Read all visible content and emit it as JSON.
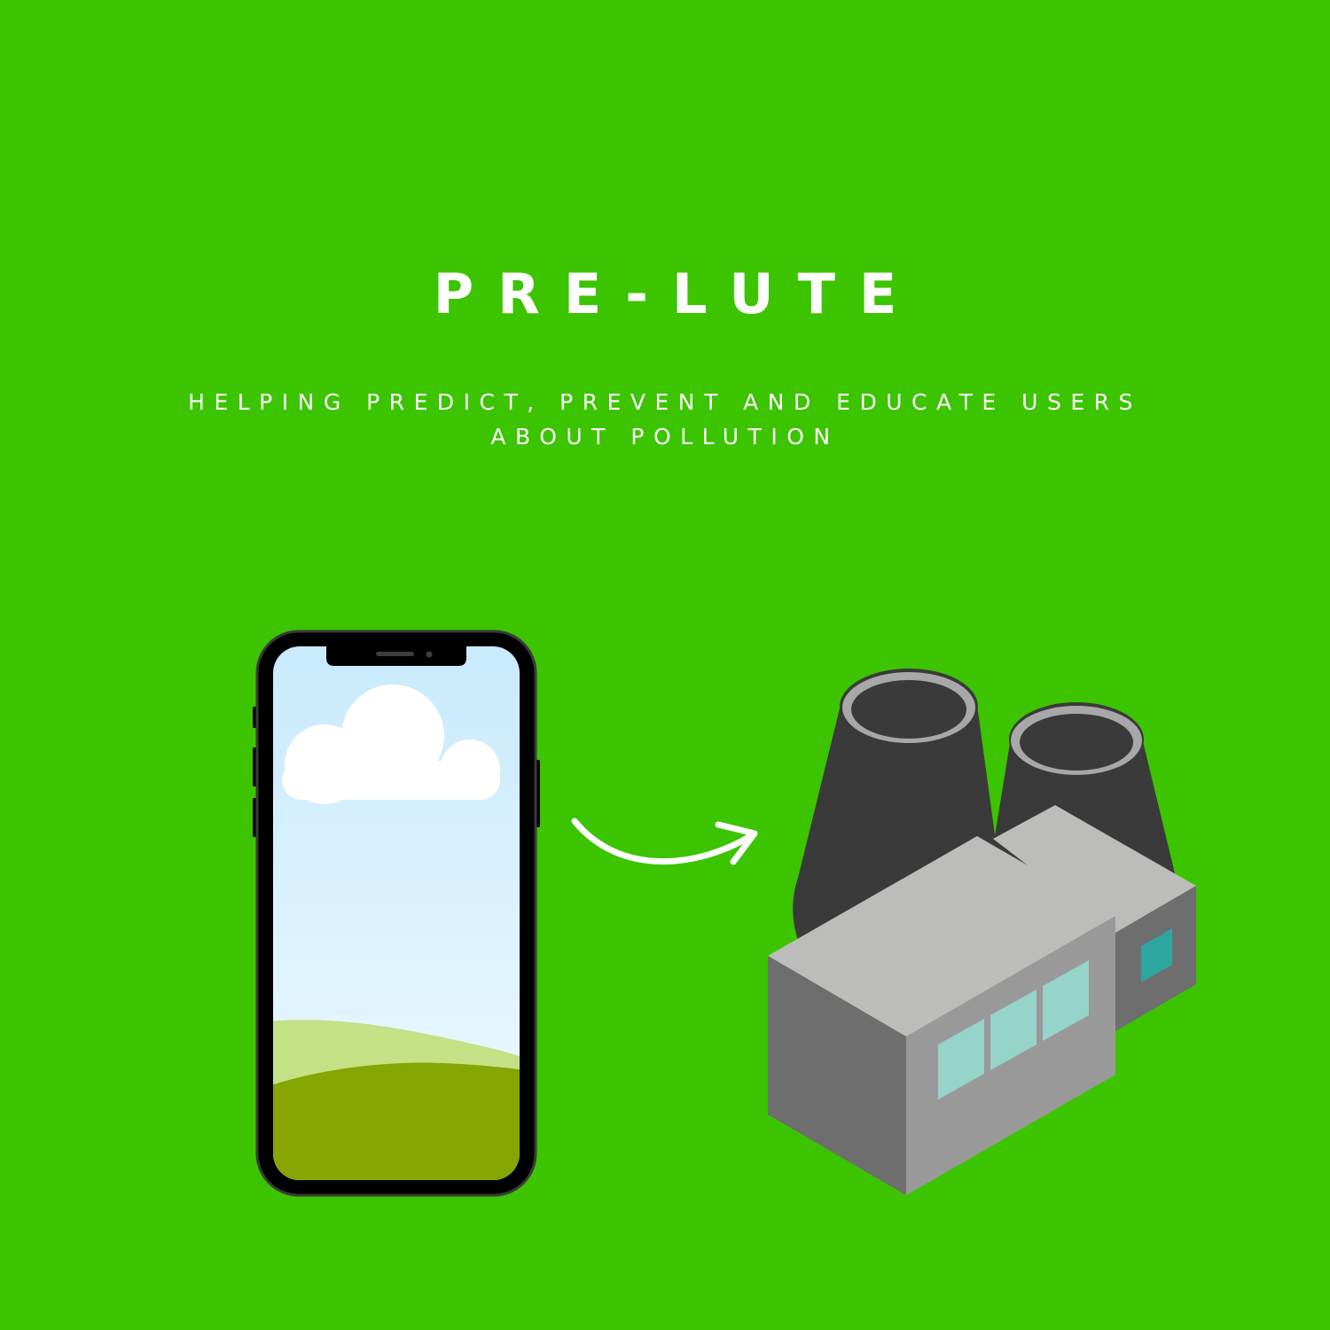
{
  "poster": {
    "title": "PRE-LUTE",
    "subtitle": "HELPING PREDICT, PREVENT AND EDUCATE USERS ABOUT POLLUTION"
  },
  "colors": {
    "background": "#3CC400",
    "text": "#FFFFFF",
    "phone_body": "#000000",
    "sky_top": "#C9EAFD",
    "sky_bottom": "#EEFAFF",
    "cloud": "#FFFFFF",
    "hill_light": "#C4E185",
    "hill_dark": "#86A500",
    "chimney": "#3A3A3A",
    "chimney_rim": "#A8A8A8",
    "building_top": "#BCBCBA",
    "building_side_light": "#999999",
    "building_side_dark": "#6E6E6E",
    "window": "#96D3C9",
    "window_accent": "#2EA7A0",
    "arrow": "#FFFFFF"
  },
  "icons": {
    "phone": "smartphone-icon",
    "cloud": "cloud-icon",
    "arrow": "curved-arrow-icon",
    "factory": "factory-icon"
  }
}
